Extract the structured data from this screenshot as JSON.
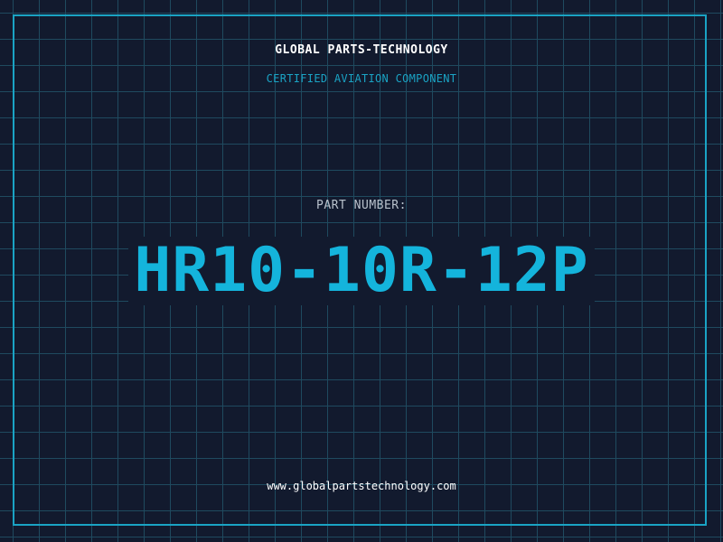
{
  "header": {
    "company_name": "GLOBAL PARTS-TECHNOLOGY",
    "tagline": "CERTIFIED AVIATION COMPONENT"
  },
  "part": {
    "label": "PART NUMBER:",
    "number": "HR10-10R-12P"
  },
  "footer": {
    "website": "www.globalpartstechnology.com"
  },
  "colors": {
    "background": "#121a2e",
    "grid": "#1f4a5f",
    "accent": "#1aa3c4",
    "part_number": "#14b4dc"
  }
}
